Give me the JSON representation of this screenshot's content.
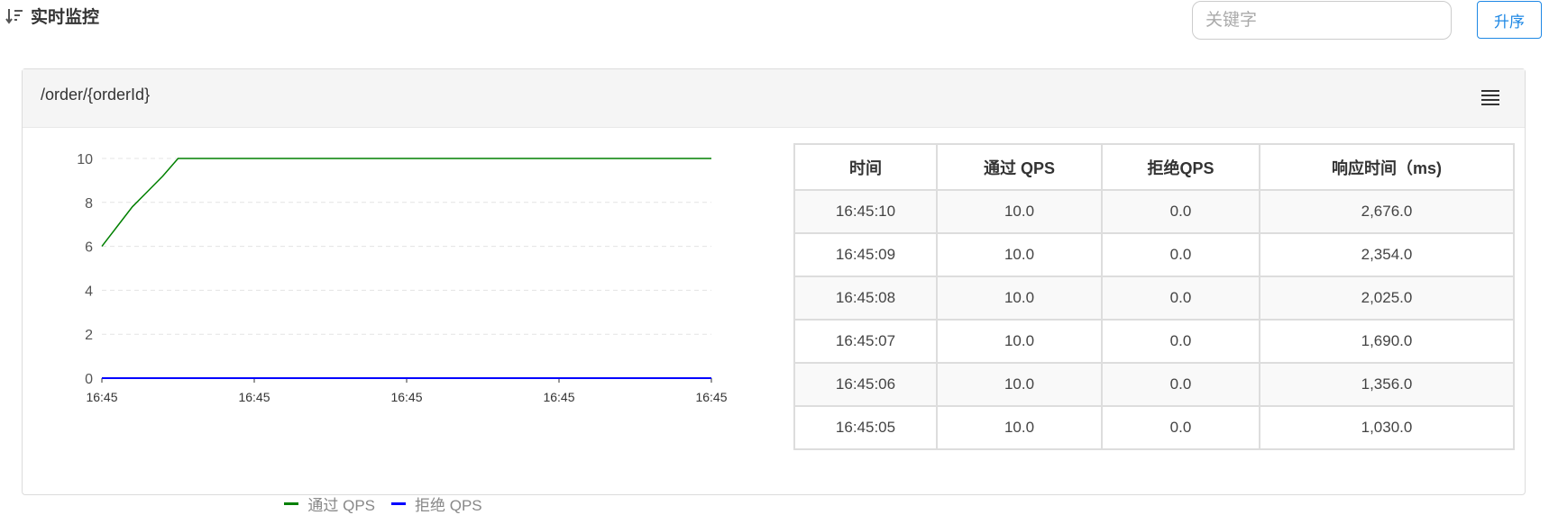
{
  "page": {
    "title": "实时监控",
    "search_placeholder": "关键字",
    "sort_button_label": "升序"
  },
  "panel": {
    "title": "/order/{orderId}",
    "table": {
      "headers": [
        "时间",
        "通过 QPS",
        "拒绝QPS",
        "响应时间（ms)"
      ],
      "rows": [
        [
          "16:45:10",
          "10.0",
          "0.0",
          "2,676.0"
        ],
        [
          "16:45:09",
          "10.0",
          "0.0",
          "2,354.0"
        ],
        [
          "16:45:08",
          "10.0",
          "0.0",
          "2,025.0"
        ],
        [
          "16:45:07",
          "10.0",
          "0.0",
          "1,690.0"
        ],
        [
          "16:45:06",
          "10.0",
          "0.0",
          "1,356.0"
        ],
        [
          "16:45:05",
          "10.0",
          "0.0",
          "1,030.0"
        ]
      ]
    }
  },
  "colors": {
    "pass": "#008000",
    "block": "#0000ff",
    "grid": "#e4e4e4",
    "axis": "#333333",
    "accent": "#1e88e5"
  },
  "icons": {
    "sort": "sort-descending-icon",
    "menu": "hamburger-menu-icon"
  },
  "chart_data": {
    "type": "line",
    "x": [
      0,
      1,
      2,
      3,
      4,
      5,
      6,
      7,
      8,
      9,
      10,
      11,
      12,
      13,
      14,
      15,
      16,
      17,
      18,
      19,
      20,
      21,
      22,
      23,
      24,
      25,
      26,
      27,
      28,
      29,
      30,
      31,
      32,
      33,
      34,
      35,
      36,
      37,
      38,
      39,
      40
    ],
    "xticks": [
      "16:45",
      "16:45",
      "16:45",
      "16:45",
      "16:45"
    ],
    "xlim": [
      0,
      40
    ],
    "ylim": [
      0,
      10
    ],
    "yticks": [
      0,
      2,
      4,
      6,
      8,
      10
    ],
    "grid": true,
    "legend_position": "bottom-center",
    "series": [
      {
        "name": "通过 QPS",
        "values": [
          6,
          6.9,
          7.8,
          8.5,
          9.2,
          10,
          10,
          10,
          10,
          10,
          10,
          10,
          10,
          10,
          10,
          10,
          10,
          10,
          10,
          10,
          10,
          10,
          10,
          10,
          10,
          10,
          10,
          10,
          10,
          10,
          10,
          10,
          10,
          10,
          10,
          10,
          10,
          10,
          10,
          10,
          10
        ]
      },
      {
        "name": "拒绝 QPS",
        "values": [
          0,
          0,
          0,
          0,
          0,
          0,
          0,
          0,
          0,
          0,
          0,
          0,
          0,
          0,
          0,
          0,
          0,
          0,
          0,
          0,
          0,
          0,
          0,
          0,
          0,
          0,
          0,
          0,
          0,
          0,
          0,
          0,
          0,
          0,
          0,
          0,
          0,
          0,
          0,
          0,
          0
        ]
      }
    ]
  }
}
